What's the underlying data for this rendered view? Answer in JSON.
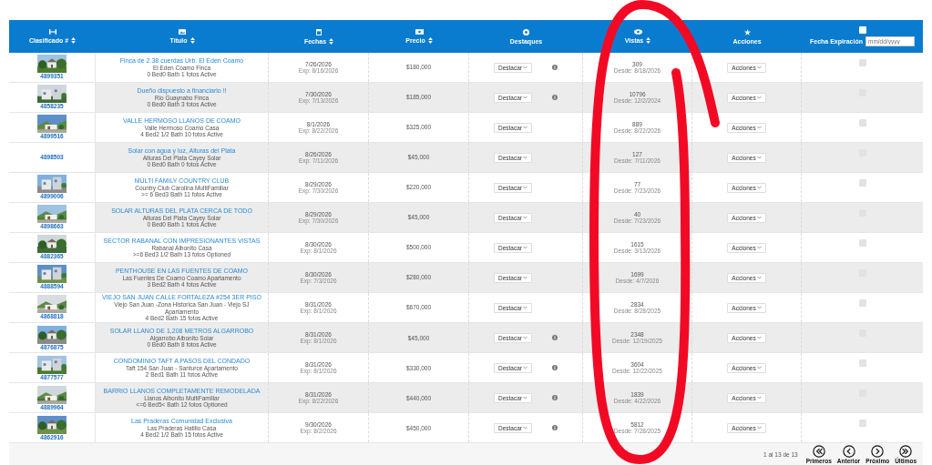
{
  "header": {
    "columns": [
      {
        "kind": "id",
        "label": "Clasificado #",
        "sortable": true
      },
      {
        "kind": "title",
        "label": "Título",
        "sortable": true
      },
      {
        "kind": "date",
        "label": "Fechas",
        "sortable": true
      },
      {
        "kind": "price",
        "label": "Precio",
        "sortable": true
      },
      {
        "kind": "feature",
        "label": "Destaques",
        "sortable": false
      },
      {
        "kind": "views",
        "label": "Vistas",
        "sortable": true
      },
      {
        "kind": "actions",
        "label": "Acciones",
        "sortable": false
      },
      {
        "kind": "expiry",
        "label": "Fecha Expiración",
        "sortable": false,
        "placeholder": "mm/dd/yyyy",
        "checked": false
      }
    ]
  },
  "rows": [
    {
      "id": "4899351",
      "photo": true,
      "title": "Finca de 2.38 cuerdas Urb. El Eden Coamo",
      "location": "El Eden Coamo Finca",
      "details": "0 Bed0 Bath 1 fotos Active",
      "date": "7/26/2026",
      "date_note": "Exp: 8/16/2026",
      "price": "$180,000",
      "feature_button": "Destacar",
      "info": true,
      "views": "309",
      "views_since": "Desde: 8/18/2026",
      "actions_button": "Acciones",
      "checked": false
    },
    {
      "id": "4858235",
      "photo": true,
      "title": "Dueño dispuesto a financiarlo !!",
      "location": "Rio Guaynabo Finca",
      "details": "0 Bed0 Bath 3 fotos Active",
      "date": "7/30/2026",
      "date_note": "Exp: 7/13/2026",
      "price": "$185,000",
      "feature_button": "Destacar",
      "info": true,
      "views": "10796",
      "views_since": "Desde: 12/2/2024",
      "actions_button": "Acciones",
      "checked": false
    },
    {
      "id": "4899516",
      "photo": true,
      "title": "VALLE HERMOSO LLANOS DE COAMO",
      "location": "Valle Hermoso Coamo Casa",
      "details": "4 Bed2 1/2 Bath 10 fotos Active",
      "date": "8/1/2026",
      "date_note": "Exp: 8/22/2026",
      "price": "$325,000",
      "feature_button": "Destacar",
      "info": false,
      "views": "889",
      "views_since": "Desde: 8/22/2026",
      "actions_button": "Acciones",
      "checked": false
    },
    {
      "id": "4898503",
      "photo": false,
      "title": "Solar con agua y luz, Alturas del Plata",
      "location": "Alturas Del Plata Cayey Solar",
      "details": "0 Bed0 Bath 0 fotos Active",
      "date": "8/26/2026",
      "date_note": "Exp: 7/11/2026",
      "price": "$45,000",
      "feature_button": "Destacar",
      "info": false,
      "views": "127",
      "views_since": "Desde: 7/11/2026",
      "actions_button": "Acciones",
      "checked": false
    },
    {
      "id": "4899006",
      "photo": true,
      "title": "MULTI FAMILY COUNTRY CLUB",
      "location": "Country Club Carolina MultiFamiliar",
      "details": ">= 6 Bed3 Bath 11 fotos Active",
      "date": "8/29/2026",
      "date_note": "Exp: 7/30/2026",
      "price": "$220,000",
      "feature_button": "Destacar",
      "info": false,
      "views": "77",
      "views_since": "Desde: 7/23/2026",
      "actions_button": "Acciones",
      "checked": false
    },
    {
      "id": "4898663",
      "photo": true,
      "title": "SOLAR ALTURAS DEL PLATA CERCA DE TODO",
      "location": "Alturas Del Plata Cayey Solar",
      "details": "0 Bed0 Bath 1 fotos Active",
      "date": "8/29/2026",
      "date_note": "Exp: 7/30/2026",
      "price": "$45,000",
      "feature_button": "Destacar",
      "info": false,
      "views": "40",
      "views_since": "Desde: 7/23/2026",
      "actions_button": "Acciones",
      "checked": false
    },
    {
      "id": "4882365",
      "photo": true,
      "title": "SECTOR RABANAL CON IMPRESIONANTES VISTAS",
      "location": "Rabanal Aibonito Casa",
      "details": ">=6 Bed3 1/2 Bath 13 fotos Optioned",
      "date": "8/30/2026",
      "date_note": "Exp: 8/1/2026",
      "price": "$500,000",
      "feature_button": "Destacar",
      "info": false,
      "views": "1615",
      "views_since": "Desde: 3/13/2026",
      "actions_button": "Acciones",
      "checked": false
    },
    {
      "id": "4888594",
      "photo": true,
      "title": "PENTHOUSE EN LAS FUENTES DE COAMO",
      "location": "Las Fuentes De Coamo Coamo Apartamento",
      "details": "3 Bed2 Bath 4 fotos Active",
      "date": "8/30/2026",
      "date_note": "Exp: 7/3/2026",
      "price": "$280,000",
      "feature_button": "Destacar",
      "info": false,
      "views": "1699",
      "views_since": "Desde: 4/7/2026",
      "actions_button": "Acciones",
      "checked": false
    },
    {
      "id": "4868818",
      "photo": true,
      "title": "VIEJO SAN JUAN CALLE FORTALEZA #254 3ER PISO",
      "location": "Viejo San Juan -Zona Historica San Juan - Viejo SJ Apartamento",
      "details": "4 Bed2 Bath 15 fotos Active",
      "date": "8/31/2026",
      "date_note": "Exp: 8/1/2026",
      "price": "$670,000",
      "feature_button": "Destacar",
      "info": false,
      "views": "2834",
      "views_since": "Desde: 8/28/2025",
      "actions_button": "Acciones",
      "checked": false
    },
    {
      "id": "4876875",
      "photo": true,
      "title": "SOLAR LLANO DE 1,208 METROS ALGARROBO",
      "location": "Algarrobo Aibonito Solar",
      "details": "0 Bed0 Bath 8 fotos Active",
      "date": "8/31/2026",
      "date_note": "Exp: 8/1/2026",
      "price": "$45,000",
      "feature_button": "Destacar",
      "info": true,
      "views": "2348",
      "views_since": "Desde: 12/19/2025",
      "actions_button": "Acciones",
      "checked": false
    },
    {
      "id": "4877577",
      "photo": true,
      "title": "CONDOMINIO TAFT A PASOS DEL CONDADO",
      "location": "Taft 154 San Juan - Santurce Apartamento",
      "details": "2 Bed1 Bath 11 fotos Active",
      "date": "8/31/2026",
      "date_note": "Exp: 8/1/2026",
      "price": "$330,000",
      "feature_button": "Destacar",
      "info": true,
      "views": "3604",
      "views_since": "Desde: 12/22/2025",
      "actions_button": "Acciones",
      "checked": false
    },
    {
      "id": "4889964",
      "photo": true,
      "title": "BARRIO LLANOS COMPLETAMENTE REMODELADA",
      "location": "Llanos Aibonito MultiFamiliar",
      "details": "<=6 Bed5< Bath 12 fotos Optioned",
      "date": "8/31/2026",
      "date_note": "Exp: 8/22/2026",
      "price": "$440,000",
      "feature_button": "Destacar",
      "info": true,
      "views": "1839",
      "views_since": "Desde: 4/22/2026",
      "actions_button": "Acciones",
      "checked": false
    },
    {
      "id": "4862916",
      "photo": true,
      "title": "Las Praderas Comunidad Exclusiva",
      "location": "Las Praderas Hatillo Casa",
      "details": "4 Bed2 1/2 Bath 15 fotos Active",
      "date": "9/30/2026",
      "date_note": "Exp: 8/2/2026",
      "price": "$450,000",
      "feature_button": "Destacar",
      "info": true,
      "views": "5812",
      "views_since": "Desde: 7/28/2025",
      "actions_button": "Acciones",
      "checked": false
    }
  ],
  "pagination": {
    "summary": "1 al 13 de 13",
    "buttons": [
      {
        "label": "Primeros"
      },
      {
        "label": "Anterior"
      },
      {
        "label": "Próximo"
      },
      {
        "label": "Últimos"
      }
    ]
  }
}
